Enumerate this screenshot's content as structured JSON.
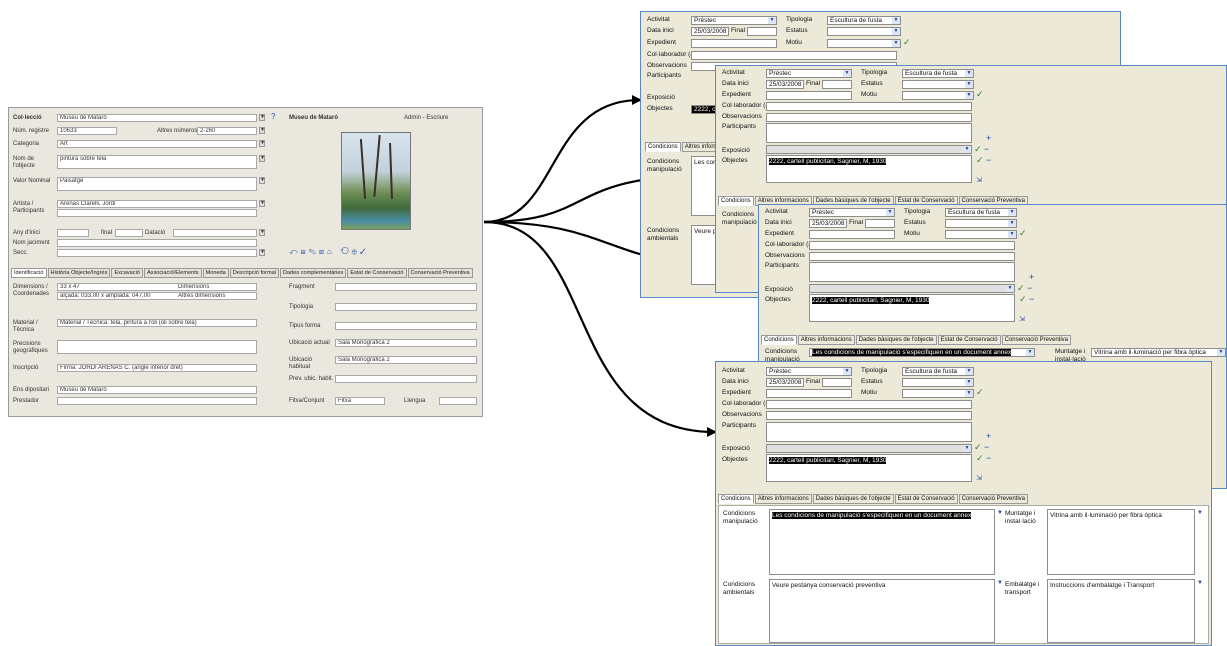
{
  "main_window": {
    "labels": {
      "collection": "Col·lecció",
      "reg_no": "Núm. registre",
      "category": "Categoria",
      "object_name": "Nom de l'objecte",
      "title": "Valor Nominal",
      "artist": "Artista / Participants",
      "year_start": "Any d'inici",
      "year_final": "final",
      "dating": "Datació",
      "deposit_name": "Nom jaciment",
      "section": "Secc.",
      "other_numbers": "Altres números"
    },
    "values": {
      "collection": "Museu de Mataró",
      "reg_no": "10633",
      "other_numbers": "2-260",
      "category": "Art",
      "object_name": "pintura sobre tela",
      "title": "Paisatge",
      "artist": "Arenas Clarelli, Jordi"
    },
    "header_right": {
      "museum": "Museu de Mataró",
      "user": "Admin - Escriure"
    },
    "tabs": [
      "Identificació",
      "Història Objecte/Ingrés",
      "Excavació",
      "Associació/Elements",
      "Moneda",
      "Descripció formal",
      "Dades complementàries",
      "Estat de Conservació",
      "Conservació Preventiva"
    ],
    "active_tab_index": 0,
    "lower": {
      "dimensions_label": "Dimensions / Coordenades",
      "dim_value1": "33 x 47",
      "dim_value2": "alçada: 033,00 x amplada: 047,00",
      "dim_header": "Dimensions",
      "dim_other": "Altres dimensions",
      "material_label": "Material / Tècnica",
      "material_value": "Material / Tècnica: tela, pintura a l'oli (oli sobre tela)",
      "precisions_label": "Precisions geogràfiques",
      "inscriptions_label": "Inscripció",
      "inscriptions_value": "Firma: JORDI ARENAS C. (angle inferior dret)",
      "deposit_label": "Ens dipositari",
      "deposit_value": "Museu de Mataró",
      "lender_label": "Prestador",
      "fragment_label": "Fragment",
      "typology_label": "Tipologia",
      "shape_label": "Tipus forma",
      "current_loc_label": "Ubicació actual",
      "current_loc_value": "Sala Monogràfica 2",
      "usual_loc_label": "Ubicació habitual",
      "usual_loc_value": "Sala Monogràfica 2",
      "prev_loc_label": "Prev. ubic. habit.",
      "set_label": "Fitxa/Conjunt",
      "set_value": "Fitxa",
      "language_label": "Llengua"
    }
  },
  "form": {
    "labels": {
      "activity": "Activitat",
      "typology": "Tipologia",
      "start_date": "Data inici",
      "final": "Final",
      "status": "Estatus",
      "file": "Expedient",
      "reason": "Motiu",
      "collaborator": "Col·laborador (a",
      "observations": "Observacions",
      "participants": "Participants",
      "exhibition": "Exposició",
      "objects": "Objectes"
    },
    "values": {
      "activity": "Préstec",
      "typology": "Escultura de fusta",
      "start_date": "25/03/2008",
      "objects": "2222, cartell publicitari, Sagnier, M, 1930",
      "objects_short": "2222, c"
    },
    "tabs": [
      "Condicions",
      "Altres informacions",
      "Dades bàsiques de l'objecte",
      "Estat de Conservació",
      "Conservació Preventiva"
    ],
    "tabs_truncated": [
      "Condicions",
      "Altres inform"
    ],
    "conditions": {
      "handling_label": "Condicions manipulació",
      "handling_value": "Les condicions de manipulació s'especifiquen en un document annex",
      "handling_short": "Les con",
      "env_label": "Condicions ambientals",
      "env_value": "Veure pestanya conservació preventiva",
      "env_short": "Veure p",
      "mount_label": "Muntatge i instal·lació",
      "mount_value": "Vitrina  amb il·luminació per fibra òptica",
      "packing_label": "Embalatge i transport",
      "packing_value": "Instruccions d'embalatge  i Transport"
    }
  },
  "icons": {
    "dropdown": "chevron-down-icon",
    "edit": "pencil-icon",
    "add": "plus-icon",
    "remove": "minus-icon",
    "link": "link-icon"
  },
  "colors": {
    "form_border": "#5b86c4",
    "form_bg": "#ece9d8",
    "main_bg": "#e9e7de"
  }
}
